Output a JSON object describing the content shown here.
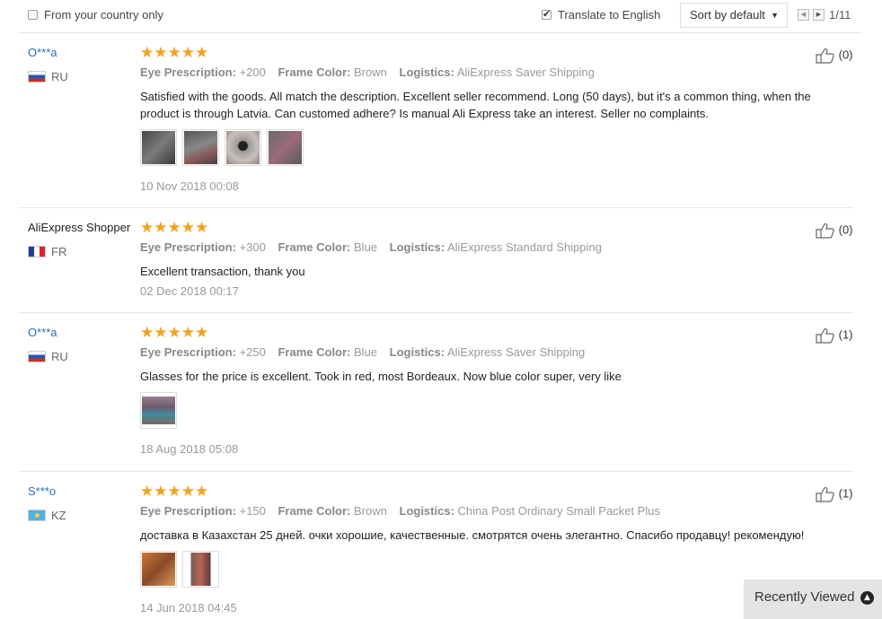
{
  "filters": {
    "country_only_label": "From your country only",
    "country_only_checked": false,
    "translate_label": "Translate to English",
    "translate_checked": true,
    "sort_label": "Sort by default",
    "pagination": "1/11"
  },
  "reviews": [
    {
      "user": "O***a",
      "country": "RU",
      "stars": "★★★★★",
      "rating": 5,
      "attr1_key": "Eye Prescription:",
      "attr1_val": "+200",
      "attr2_key": "Frame Color:",
      "attr2_val": "Brown",
      "attr3_key": "Logistics:",
      "attr3_val": "AliExpress Saver Shipping",
      "text": "Satisfied with the goods. All match the description. Excellent seller recommend. Long (50 days), but it's a common thing, when the product is through Latvia. Can customed adhere? Is manual Ali Express take an interest. Seller no complaints.",
      "date": "10 Nov 2018 00:08",
      "likes": "(0)"
    },
    {
      "user": "AliExpress Shopper",
      "country": "FR",
      "stars": "★★★★★",
      "rating": 5,
      "attr1_key": "Eye Prescription:",
      "attr1_val": "+300",
      "attr2_key": "Frame Color:",
      "attr2_val": "Blue",
      "attr3_key": "Logistics:",
      "attr3_val": "AliExpress Standard Shipping",
      "text": "Excellent transaction, thank you",
      "date": "02 Dec 2018 00:17",
      "likes": "(0)"
    },
    {
      "user": "O***a",
      "country": "RU",
      "stars": "★★★★★",
      "rating": 5,
      "attr1_key": "Eye Prescription:",
      "attr1_val": "+250",
      "attr2_key": "Frame Color:",
      "attr2_val": "Blue",
      "attr3_key": "Logistics:",
      "attr3_val": "AliExpress Saver Shipping",
      "text": "Glasses for the price is excellent. Took in red, most Bordeaux. Now blue color super, very like",
      "date": "18 Aug 2018 05:08",
      "likes": "(1)"
    },
    {
      "user": "S***o",
      "country": "KZ",
      "stars": "★★★★★",
      "rating": 5,
      "attr1_key": "Eye Prescription:",
      "attr1_val": "+150",
      "attr2_key": "Frame Color:",
      "attr2_val": "Brown",
      "attr3_key": "Logistics:",
      "attr3_val": "China Post Ordinary Small Packet Plus",
      "text": "доставка в Казахстан 25 дней. очки хорошие, качественные. смотрятся очень элегантно. Спасибо продавцу! рекомендую!",
      "date": "14 Jun 2018 04:45",
      "likes": "(1)"
    }
  ],
  "recently_viewed": "Recently Viewed",
  "colors": {
    "star": "#f4a21d",
    "link": "#2a6ebb"
  }
}
